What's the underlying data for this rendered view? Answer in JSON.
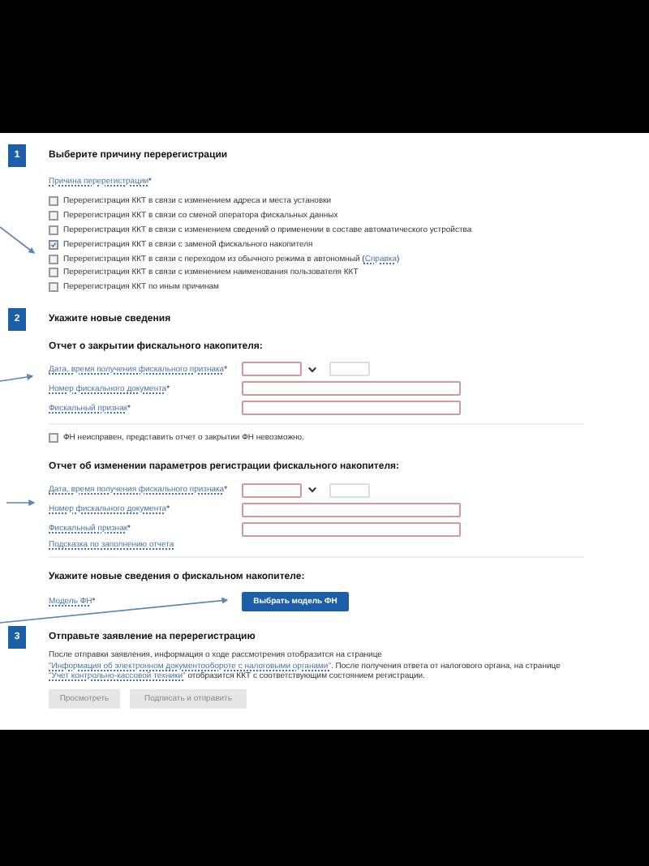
{
  "section_1": {
    "number": "1",
    "title": "Выберите причину перерегистрации",
    "reason_label": "Причина перерегистрации",
    "reason_mark": "*",
    "options": [
      {
        "label": "Перерегистрация ККТ в связи с изменением адреса и места установки",
        "checked": false
      },
      {
        "label": "Перерегистрация ККТ в связи со сменой оператора фискальных данных",
        "checked": false
      },
      {
        "label": "Перерегистрация ККТ в связи с изменением сведений о применении в составе автоматического устройства",
        "checked": false
      },
      {
        "label": "Перерегистрация ККТ в связи с заменой фискального накопителя",
        "checked": true
      },
      {
        "label": "Перерегистрация ККТ в связи с переходом из обычного режима в автономный (",
        "link": "Справка",
        "label_end": ")",
        "checked": false
      },
      {
        "label": "Перерегистрация ККТ в связи с изменением наименования пользователя ККТ",
        "checked": false
      },
      {
        "label": "Перерегистрация ККТ по иным причинам",
        "checked": false
      }
    ]
  },
  "section_2": {
    "number": "2",
    "title": "Укажите новые сведения",
    "reports": [
      {
        "title": "Отчет о закрытии фискального накопителя:",
        "fields": [
          {
            "kind": "datetime",
            "label": "Дата, время получения фискального признака",
            "mark": "*"
          },
          {
            "kind": "text",
            "label": "Номер фискального документа",
            "mark": "*"
          },
          {
            "kind": "text",
            "label": "Фискальный признак",
            "mark": "*"
          }
        ],
        "checkbox": {
          "label": "ФН неисправен, представить отчет о закрытии ФН невозможно.",
          "checked": false
        }
      },
      {
        "title": "Отчет об изменении параметров регистрации фискального накопителя:",
        "fields": [
          {
            "kind": "datetime",
            "label": "Дата, время получения фискального признака",
            "mark": "*"
          },
          {
            "kind": "text",
            "label": "Номер фискального документа",
            "mark": "*"
          },
          {
            "kind": "text",
            "label": "Фискальный признак",
            "mark": "*"
          }
        ],
        "hint_link": "Подсказка по заполнению отчета"
      }
    ],
    "new_info": {
      "title": "Укажите новые сведения о фискальном накопителе:",
      "model_label": "Модель ФН",
      "model_mark": "*",
      "button": "Выбрать модель ФН"
    }
  },
  "section_3": {
    "number": "3",
    "title": "Отправьте заявление на перерегистрацию",
    "paragraph": [
      {
        "kind": "text",
        "text": "После отправки заявления, информация о ходе рассмотрения отобразится на странице "
      },
      {
        "kind": "link",
        "text": "\"Информация об электронном документообороте с налоговыми органами\""
      },
      {
        "kind": "text",
        "text": ". После получения ответа от налогового органа, на странице "
      },
      {
        "kind": "link",
        "text": "\"Учет контрольно-кассовой техники\""
      },
      {
        "kind": "text",
        "text": " отобразится ККТ с соответствующим состоянием регистрации."
      }
    ],
    "buttons": [
      {
        "label": "Просмотреть",
        "disabled": true
      },
      {
        "label": "Подписать и отправить",
        "disabled": true
      }
    ]
  }
}
